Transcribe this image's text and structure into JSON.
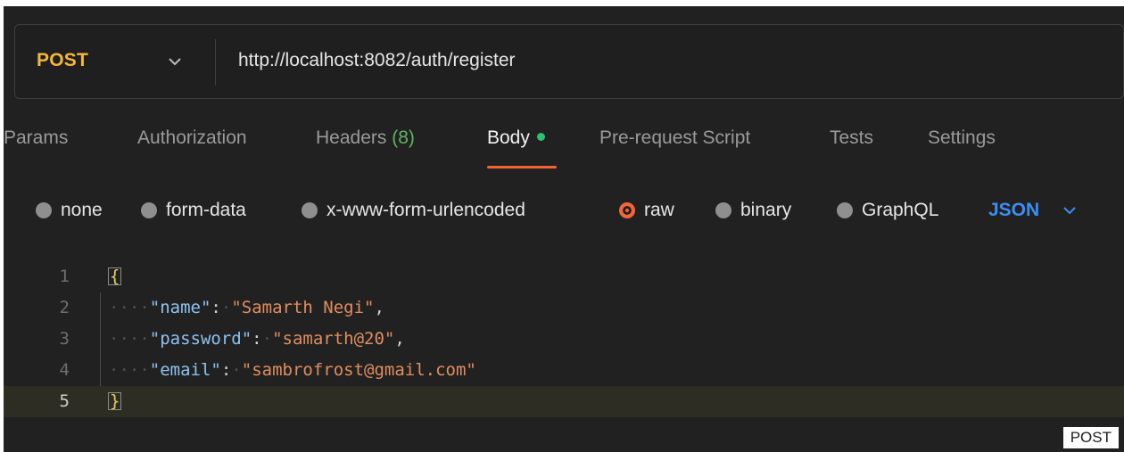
{
  "request": {
    "method": "POST",
    "url": "http://localhost:8082/auth/register"
  },
  "tabs": [
    {
      "label": "Params"
    },
    {
      "label": "Authorization"
    },
    {
      "label": "Headers",
      "count": "(8)"
    },
    {
      "label": "Body"
    },
    {
      "label": "Pre-request Script"
    },
    {
      "label": "Tests"
    },
    {
      "label": "Settings"
    }
  ],
  "body_types": [
    {
      "label": "none"
    },
    {
      "label": "form-data"
    },
    {
      "label": "x-www-form-urlencoded"
    },
    {
      "label": "raw"
    },
    {
      "label": "binary"
    },
    {
      "label": "GraphQL"
    }
  ],
  "selected_body_type": "raw",
  "format": "JSON",
  "editor": {
    "line_numbers": [
      "1",
      "2",
      "3",
      "4",
      "5"
    ],
    "open_brace": "{",
    "close_brace": "}",
    "fields": [
      {
        "key": "\"name\"",
        "value": "\"Samarth Negi\""
      },
      {
        "key": "\"password\"",
        "value": "\"samarth@20\""
      },
      {
        "key": "\"email\"",
        "value": "\"sambrofrost@gmail.com\""
      }
    ]
  },
  "footer_label": "POST",
  "colors": {
    "method": "#f5b63a",
    "active_tab_underline": "#f16331",
    "body_dot": "#2bc26b",
    "format": "#3b8ef3",
    "json_key": "#8dc3f0",
    "json_string": "#e18d5f"
  }
}
